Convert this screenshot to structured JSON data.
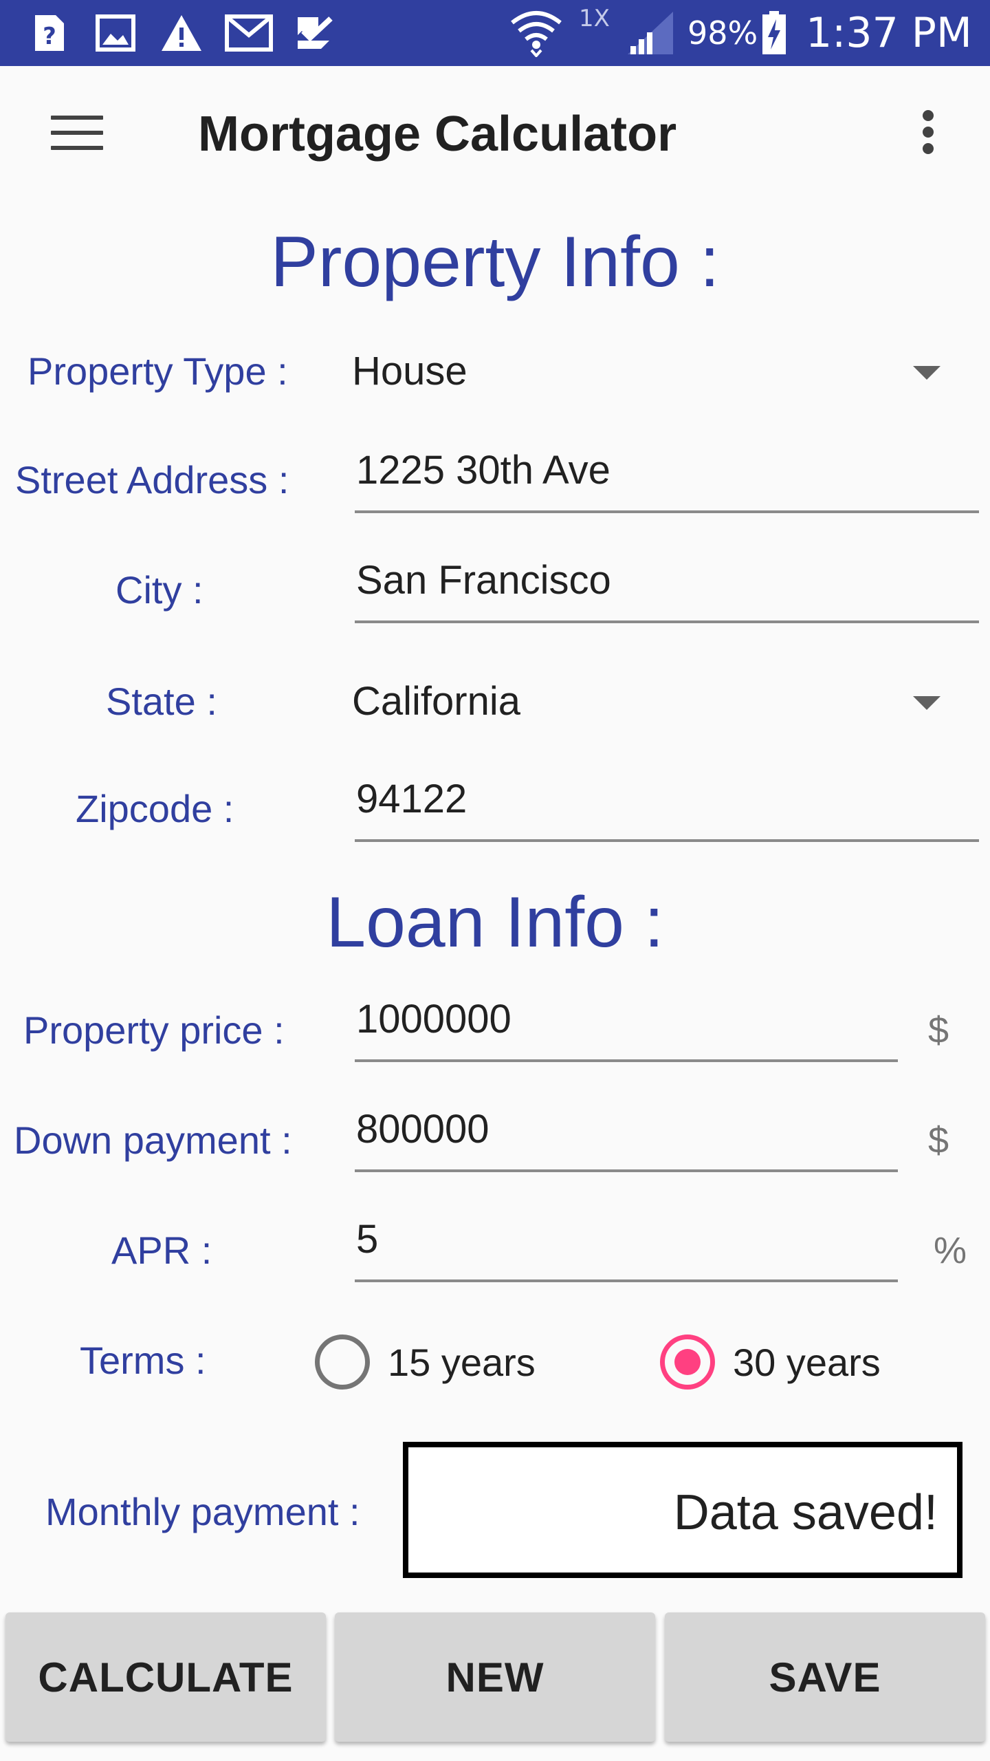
{
  "status_bar": {
    "network_badge": "1X",
    "battery": "98%",
    "time": "1:37 PM",
    "background": "#303f9f",
    "icons": [
      "unknown-file-icon",
      "image-icon",
      "warning-icon",
      "gmail-icon",
      "checklist-icon",
      "wifi-icon",
      "cell-signal-icon",
      "battery-charging-icon"
    ]
  },
  "toolbar": {
    "title": "Mortgage Calculator",
    "icons": [
      "hamburger-menu-icon",
      "overflow-menu-icon"
    ]
  },
  "property_info": {
    "heading": "Property Info :",
    "property_type": {
      "label": "Property Type :",
      "value": "House"
    },
    "street_address": {
      "label": "Street Address :",
      "value": "1225 30th Ave"
    },
    "city": {
      "label": "City :",
      "value": "San Francisco"
    },
    "state": {
      "label": "State :",
      "value": "California"
    },
    "zipcode": {
      "label": "Zipcode :",
      "value": "94122"
    }
  },
  "loan_info": {
    "heading": "Loan Info :",
    "property_price": {
      "label": "Property price :",
      "value": "1000000",
      "unit": "$"
    },
    "down_payment": {
      "label": "Down payment :",
      "value": "800000",
      "unit": "$"
    },
    "apr": {
      "label": "APR :",
      "value": "5",
      "unit": "%"
    },
    "terms": {
      "label": "Terms :",
      "options": [
        {
          "label": "15 years",
          "selected": false
        },
        {
          "label": "30 years",
          "selected": true
        }
      ]
    }
  },
  "monthly_payment": {
    "label": "Monthly payment :",
    "result_text": "Data saved!"
  },
  "buttons": {
    "calculate": "CALCULATE",
    "new": "NEW",
    "save": "SAVE"
  },
  "colors": {
    "primary": "#303f9f",
    "accent": "#ff4081",
    "button": "#d6d6d6"
  }
}
